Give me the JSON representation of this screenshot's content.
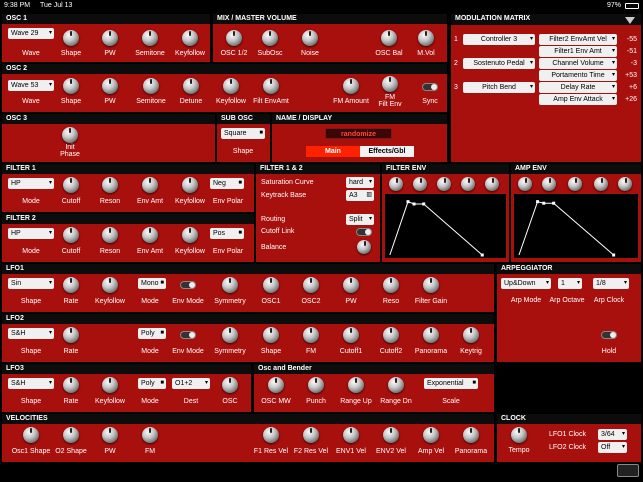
{
  "status": {
    "time": "9:38 PM",
    "date": "Tue Jul 13",
    "battery": "97%"
  },
  "osc1": {
    "title": "OSC 1",
    "wave": "Wave 29",
    "labels": [
      "Wave",
      "Shape",
      "PW",
      "Semitone",
      "Keyfollow"
    ]
  },
  "mix": {
    "title": "MIX / MASTER VOLUME",
    "labels": [
      "OSC 1/2",
      "SubOsc",
      "Noise",
      "OSC Bal",
      "M.Vol"
    ]
  },
  "osc2": {
    "title": "OSC 2",
    "wave": "Wave 53",
    "labels": [
      "Wave",
      "Shape",
      "PW",
      "Semitone",
      "Detune",
      "Keyfollow",
      "Filt EnvAmt",
      "FM Amount",
      "FM\nFilt Env",
      "Sync"
    ],
    "fm_label": "FM",
    "fm_sub": "Filt Env"
  },
  "osc3": {
    "title": "OSC 3",
    "label1": "Init",
    "label2": "Phase"
  },
  "subosc": {
    "title": "SUB OSC",
    "wave": "Square",
    "label": "Shape"
  },
  "name": {
    "title": "NAME / DISPLAY",
    "randomize": "randomize",
    "main": "Main",
    "effects": "Effects/Gbl"
  },
  "matrix": {
    "title": "MODULATION MATRIX",
    "rows": [
      {
        "num": "1",
        "src": "Controller 3",
        "dst": "Filter2 EnvAmt Vel",
        "val": "-55"
      },
      {
        "num": "",
        "src": "",
        "dst": "Filter1 Env Amt",
        "val": "-51"
      },
      {
        "num": "2",
        "src": "Sostenuto Pedal",
        "dst": "Channel Volume",
        "val": "-3"
      },
      {
        "num": "",
        "src": "",
        "dst": "Portamento Time",
        "val": "+53"
      },
      {
        "num": "3",
        "src": "Pitch Bend",
        "dst": "Delay Rate",
        "val": "+6"
      },
      {
        "num": "",
        "src": "",
        "dst": "Amp Env Attack",
        "val": "+26"
      }
    ]
  },
  "filter1": {
    "title": "FILTER 1",
    "mode": "HP",
    "polar": "Neg",
    "labels": [
      "Mode",
      "Cutoff",
      "Reson",
      "Env Amt",
      "Keyfollow",
      "Env Polar"
    ]
  },
  "filter2": {
    "title": "FILTER 2",
    "mode": "HP",
    "polar": "Pos",
    "labels": [
      "Mode",
      "Cutoff",
      "Reson",
      "Env Amt",
      "Keyfollow",
      "Env Polar"
    ]
  },
  "filter12": {
    "title": "FILTER 1 & 2",
    "sat_label": "Saturation Curve",
    "sat": "hard",
    "kt_label": "Keytrack Base",
    "kt": "A3",
    "routing_label": "Routing",
    "routing": "Split",
    "cutoff_link": "Cutoff Link",
    "balance": "Balance"
  },
  "filterenv": {
    "title": "FILTER ENV",
    "env": [
      0.15,
      0.05,
      0.12,
      0.98
    ]
  },
  "ampenv": {
    "title": "AMP ENV",
    "env": [
      0.15,
      0.05,
      0.08,
      0.98
    ]
  },
  "lfo1": {
    "title": "LFO1",
    "shape": "Sin",
    "mode": "Mono",
    "labels": [
      "Shape",
      "Rate",
      "Keyfollow",
      "Mode",
      "Env Mode",
      "Symmetry",
      "OSC1",
      "OSC2",
      "PW",
      "Reso",
      "Filter Gain"
    ]
  },
  "lfo2": {
    "title": "LFO2",
    "shape": "S&H",
    "mode": "Poly",
    "labels": [
      "Shape",
      "Rate",
      "Mode",
      "Env Mode",
      "Symmetry",
      "Shape",
      "FM",
      "Cutoff1",
      "Cutoff2",
      "Panorama",
      "Keytrig"
    ]
  },
  "lfo3": {
    "title": "LFO3",
    "shape": "S&H",
    "mode": "Poly",
    "dest": "O1+2",
    "labels": [
      "Shape",
      "Rate",
      "Keyfollow",
      "Mode",
      "Dest",
      "OSC"
    ]
  },
  "arp": {
    "title": "ARPEGGIATOR",
    "mode": "Up&Down",
    "octave": "1",
    "clock": "1/8",
    "labels": [
      "Arp Mode",
      "Arp Octave",
      "Arp Clock",
      "Hold"
    ]
  },
  "bender": {
    "title": "Osc and Bender",
    "scale": "Exponential",
    "labels": [
      "OSC MW",
      "Punch",
      "Range Up",
      "Range Dn",
      "Scale"
    ]
  },
  "velocities": {
    "title": "VELOCITIES",
    "labels": [
      "Osc1 Shape",
      "O2 Shape",
      "PW",
      "FM",
      "F1 Res Vel",
      "F2 Res Vel",
      "ENV1 Vel",
      "ENV2 Vel",
      "Amp Vel",
      "Panorama"
    ]
  },
  "clock": {
    "title": "CLOCK",
    "tempo": "Tempo",
    "lfo1_label": "LFO1 Clock",
    "lfo1": "3/64",
    "lfo2_label": "LFO2 Clock",
    "lfo2": "Off"
  }
}
